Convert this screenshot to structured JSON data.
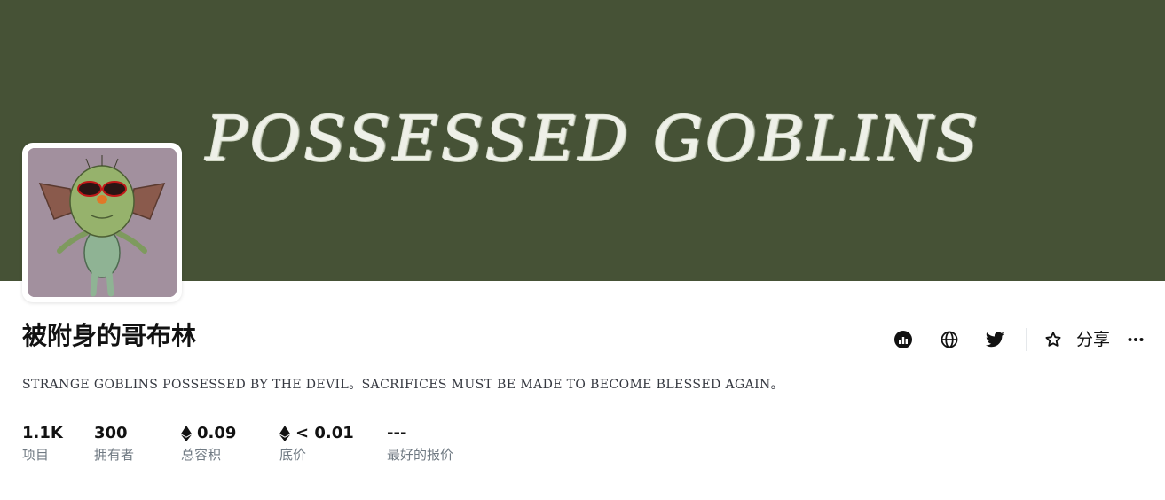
{
  "banner": {
    "title": "POSSESSED GOBLINS",
    "background": "#465236"
  },
  "collection": {
    "name": "被附身的哥布林",
    "description": "STRANGE GOBLINS POSSESSED BY THE DEVIL。SACRIFICES MUST BE MADE TO BECOME BLESSED AGAIN。"
  },
  "actions": {
    "items": [
      {
        "icon": "activity-chart-icon"
      },
      {
        "icon": "globe-icon"
      },
      {
        "icon": "twitter-icon"
      }
    ],
    "favorite_icon": "star-icon",
    "share_label": "分享",
    "more_icon": "more-dots-icon"
  },
  "stats": [
    {
      "value": "1.1K",
      "label": "项目",
      "eth": false
    },
    {
      "value": "300",
      "label": "拥有者",
      "eth": false
    },
    {
      "value": "0.09",
      "label": "总容积",
      "eth": true
    },
    {
      "value": "< 0.01",
      "label": "底价",
      "eth": true
    },
    {
      "value": "---",
      "label": "最好的报价",
      "eth": false
    }
  ],
  "colors": {
    "text": "#121212",
    "muted": "#707a83",
    "avatar_bg": "#a2909e"
  }
}
